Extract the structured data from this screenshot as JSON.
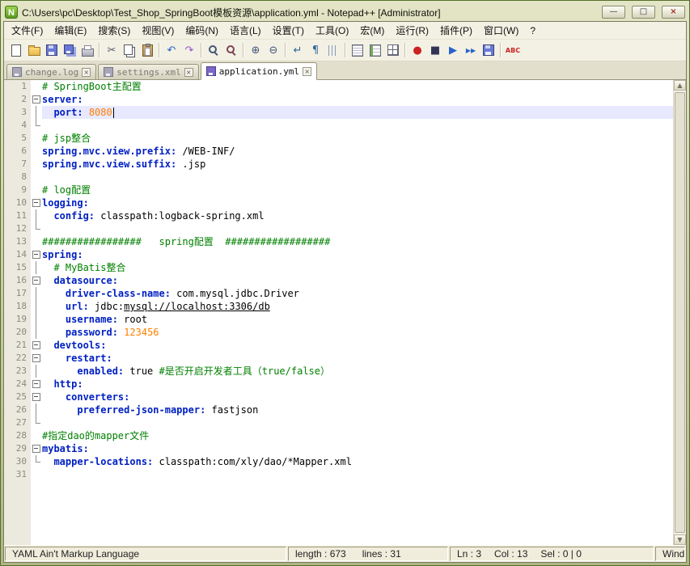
{
  "window": {
    "title": "C:\\Users\\pc\\Desktop\\Test_Shop_SpringBoot模板资源\\application.yml - Notepad++ [Administrator]",
    "app_icon_glyph": "N",
    "controls": {
      "minimize": "—",
      "maximize": "□",
      "close": "×"
    }
  },
  "menu": {
    "items": [
      "文件(F)",
      "编辑(E)",
      "搜索(S)",
      "视图(V)",
      "编码(N)",
      "语言(L)",
      "设置(T)",
      "工具(O)",
      "宏(M)",
      "运行(R)",
      "插件(P)",
      "窗口(W)",
      "?"
    ]
  },
  "toolbar": {
    "buttons": [
      {
        "name": "new-file",
        "shape": "ig-page"
      },
      {
        "name": "open-file",
        "shape": "ig-folder"
      },
      {
        "name": "save",
        "shape": "ig-floppy"
      },
      {
        "name": "save-all",
        "shape": "ig-floppy2"
      },
      {
        "name": "print",
        "shape": "ig-printer"
      },
      {
        "sep": true
      },
      {
        "name": "cut",
        "glyph": "✂",
        "color": "#555566"
      },
      {
        "name": "copy",
        "shape": "ig-copy"
      },
      {
        "name": "paste",
        "shape": "ig-paste"
      },
      {
        "sep": true
      },
      {
        "name": "undo",
        "glyph": "↶",
        "color": "#2a62c9"
      },
      {
        "name": "redo",
        "glyph": "↷",
        "color": "#9a55cc"
      },
      {
        "sep": true
      },
      {
        "name": "find",
        "shape": "ig-magnify"
      },
      {
        "name": "replace",
        "shape": "ig-magnify-r"
      },
      {
        "sep": true
      },
      {
        "name": "zoom-in",
        "glyph": "⊕",
        "color": "#445577"
      },
      {
        "name": "zoom-out",
        "glyph": "⊖",
        "color": "#445577"
      },
      {
        "sep": true
      },
      {
        "name": "word-wrap",
        "glyph": "↵",
        "color": "#336699"
      },
      {
        "name": "show-all-characters",
        "glyph": "¶",
        "color": "#336699"
      },
      {
        "name": "indent-guide",
        "shape": "ig-indent"
      },
      {
        "sep": true
      },
      {
        "name": "document-map",
        "shape": "ig-map"
      },
      {
        "name": "function-list",
        "shape": "ig-funclist"
      },
      {
        "name": "doc-switcher",
        "shape": "ig-grid"
      },
      {
        "sep": true
      },
      {
        "name": "record-macro",
        "glyph": "●",
        "color": "#cc2222"
      },
      {
        "name": "stop-macro",
        "glyph": "■",
        "color": "#333355"
      },
      {
        "name": "play-macro",
        "glyph": "▶",
        "color": "#2a62c9"
      },
      {
        "name": "run-macro-multiple",
        "glyph": "▶▶",
        "color": "#2a62c9",
        "small": true
      },
      {
        "name": "save-macro",
        "shape": "ig-floppy"
      },
      {
        "sep": true
      },
      {
        "name": "spell-check",
        "glyph": "ABC",
        "color": "#cc2222",
        "small": true
      }
    ]
  },
  "tabbar": {
    "close_glyph": "×",
    "tabs": [
      {
        "label": "change.log",
        "active": false
      },
      {
        "label": "settings.xml",
        "active": false
      },
      {
        "label": "application.yml",
        "active": true
      }
    ]
  },
  "editor": {
    "scrollbar": {
      "up": "▲",
      "down": "▼"
    },
    "lines": [
      {
        "n": 1,
        "fold": "",
        "tokens": [
          [
            "c",
            "# SpringBoot主配置"
          ]
        ]
      },
      {
        "n": 2,
        "fold": "box",
        "tokens": [
          [
            "k",
            "server:"
          ]
        ]
      },
      {
        "n": 3,
        "fold": "line",
        "current": true,
        "caret": true,
        "tokens": [
          [
            "t",
            "  "
          ],
          [
            "k",
            "port:"
          ],
          [
            "t",
            " "
          ],
          [
            "n",
            "8080"
          ]
        ]
      },
      {
        "n": 4,
        "fold": "end",
        "tokens": []
      },
      {
        "n": 5,
        "fold": "",
        "tokens": [
          [
            "c",
            "# jsp整合"
          ]
        ]
      },
      {
        "n": 6,
        "fold": "",
        "tokens": [
          [
            "k",
            "spring.mvc.view.prefix:"
          ],
          [
            "t",
            " /WEB-INF/"
          ]
        ]
      },
      {
        "n": 7,
        "fold": "",
        "tokens": [
          [
            "k",
            "spring.mvc.view.suffix:"
          ],
          [
            "t",
            " .jsp"
          ]
        ]
      },
      {
        "n": 8,
        "fold": "",
        "tokens": []
      },
      {
        "n": 9,
        "fold": "",
        "tokens": [
          [
            "c",
            "# log配置"
          ]
        ]
      },
      {
        "n": 10,
        "fold": "box",
        "tokens": [
          [
            "k",
            "logging:"
          ]
        ]
      },
      {
        "n": 11,
        "fold": "line",
        "tokens": [
          [
            "t",
            "  "
          ],
          [
            "k",
            "config:"
          ],
          [
            "t",
            " classpath:logback-spring.xml"
          ]
        ]
      },
      {
        "n": 12,
        "fold": "end",
        "tokens": []
      },
      {
        "n": 13,
        "fold": "",
        "tokens": [
          [
            "c",
            "#################   spring配置  ##################"
          ]
        ]
      },
      {
        "n": 14,
        "fold": "box",
        "tokens": [
          [
            "k",
            "spring:"
          ]
        ]
      },
      {
        "n": 15,
        "fold": "line",
        "tokens": [
          [
            "t",
            "  "
          ],
          [
            "c",
            "# MyBatis整合"
          ]
        ]
      },
      {
        "n": 16,
        "fold": "box",
        "tokens": [
          [
            "t",
            "  "
          ],
          [
            "k",
            "datasource:"
          ]
        ]
      },
      {
        "n": 17,
        "fold": "line",
        "tokens": [
          [
            "t",
            "    "
          ],
          [
            "k",
            "driver-class-name:"
          ],
          [
            "t",
            " com.mysql.jdbc.Driver"
          ]
        ]
      },
      {
        "n": 18,
        "fold": "line",
        "tokens": [
          [
            "t",
            "    "
          ],
          [
            "k",
            "url:"
          ],
          [
            "t",
            " jdbc:"
          ],
          [
            "u",
            "mysql://localhost:3306/db"
          ]
        ]
      },
      {
        "n": 19,
        "fold": "line",
        "tokens": [
          [
            "t",
            "    "
          ],
          [
            "k",
            "username:"
          ],
          [
            "t",
            " root"
          ]
        ]
      },
      {
        "n": 20,
        "fold": "line",
        "tokens": [
          [
            "t",
            "    "
          ],
          [
            "k",
            "password:"
          ],
          [
            "t",
            " "
          ],
          [
            "n",
            "123456"
          ]
        ]
      },
      {
        "n": 21,
        "fold": "box",
        "tokens": [
          [
            "t",
            "  "
          ],
          [
            "k",
            "devtools:"
          ]
        ]
      },
      {
        "n": 22,
        "fold": "box",
        "tokens": [
          [
            "t",
            "    "
          ],
          [
            "k",
            "restart:"
          ]
        ]
      },
      {
        "n": 23,
        "fold": "line",
        "tokens": [
          [
            "t",
            "      "
          ],
          [
            "k",
            "enabled:"
          ],
          [
            "t",
            " true "
          ],
          [
            "c",
            "#是否开启开发者工具（true/false）"
          ]
        ]
      },
      {
        "n": 24,
        "fold": "box",
        "tokens": [
          [
            "t",
            "  "
          ],
          [
            "k",
            "http:"
          ]
        ]
      },
      {
        "n": 25,
        "fold": "box",
        "tokens": [
          [
            "t",
            "    "
          ],
          [
            "k",
            "converters:"
          ]
        ]
      },
      {
        "n": 26,
        "fold": "line",
        "tokens": [
          [
            "t",
            "      "
          ],
          [
            "k",
            "preferred-json-mapper:"
          ],
          [
            "t",
            " fastjson"
          ]
        ]
      },
      {
        "n": 27,
        "fold": "end",
        "tokens": []
      },
      {
        "n": 28,
        "fold": "",
        "tokens": [
          [
            "c",
            "#指定dao的mapper文件"
          ]
        ]
      },
      {
        "n": 29,
        "fold": "box",
        "tokens": [
          [
            "k",
            "mybatis:"
          ]
        ]
      },
      {
        "n": 30,
        "fold": "end",
        "tokens": [
          [
            "t",
            "  "
          ],
          [
            "k",
            "mapper-locations:"
          ],
          [
            "t",
            " classpath:com/xly/dao/*Mapper.xml"
          ]
        ]
      },
      {
        "n": 31,
        "fold": "",
        "tokens": []
      }
    ]
  },
  "statusbar": {
    "doc_type": "YAML Ain't Markup Language",
    "length_label": "length : 673",
    "lines_label": "lines : 31",
    "ln_label": "Ln : 3",
    "col_label": "Col : 13",
    "sel_label": "Sel : 0 | 0",
    "eol_label": "Windo"
  }
}
